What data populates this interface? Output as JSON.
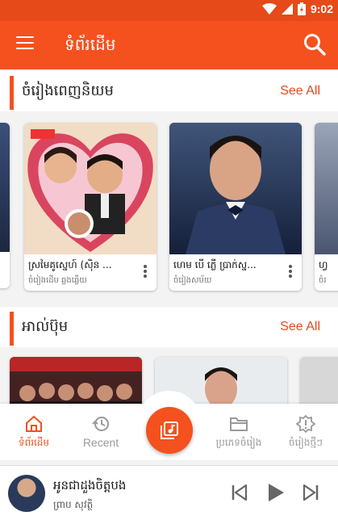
{
  "status_bar": {
    "time": "9:02",
    "battery_icon": "battery-charging-icon",
    "signal_icon": "signal-icon",
    "wifi_icon": "wifi-icon"
  },
  "app_bar": {
    "title": "ទំព័រដើម",
    "menu_icon": "menu-icon",
    "search_icon": "search-icon"
  },
  "popular_section": {
    "title": "ចំរៀងពេញនិយម",
    "see_all": "See All",
    "cards": [
      {
        "title": "ស្រមៃគូស្នេហ៍ (ស៊ិន ...",
        "subtitle": "ចំរៀងដើម ឆ្លងឆ្លើយ"
      },
      {
        "title": "ហេម បេី ភ្លើ ប្រាក់ស្ន...",
        "subtitle": "ចំរៀងសម័យ"
      },
      {
        "title": "ហ្វ",
        "subtitle": "ចំរ"
      }
    ]
  },
  "album_section": {
    "title": "អាល់ប៊ុម",
    "see_all": "See All"
  },
  "bottom_nav": {
    "items": [
      {
        "label": "ទំព័រដើម",
        "icon": "home-icon",
        "active": true
      },
      {
        "label": "Recent",
        "icon": "history-icon",
        "active": false
      },
      {
        "label": "ប្រភេទចំរៀង",
        "icon": "folder-icon",
        "active": false
      },
      {
        "label": "ចំរៀងថ្មីៗ",
        "icon": "new-alert-icon",
        "active": false
      }
    ],
    "center_icon": "music-library-icon"
  },
  "player": {
    "title": "អូនជាដួងចិត្តបង",
    "artist": "ព្រាប សុវត្ថិ",
    "prev_icon": "skip-previous-icon",
    "play_icon": "play-icon",
    "next_icon": "skip-next-icon"
  },
  "colors": {
    "primary": "#f4511e",
    "status_bar": "#e64a19",
    "background": "#f3f3f3"
  }
}
